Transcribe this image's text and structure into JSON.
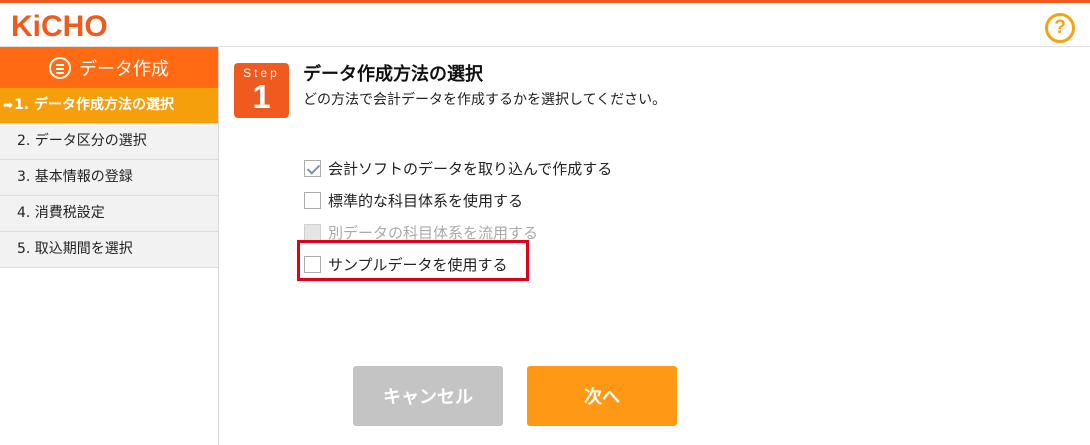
{
  "header": {
    "logo_text": "KiCHO",
    "help_icon_glyph": "?"
  },
  "sidebar": {
    "header_label": "データ作成",
    "header_icon": "list-icon",
    "items": [
      {
        "label": "1. データ作成方法の選択",
        "active": true
      },
      {
        "label": "2. データ区分の選択"
      },
      {
        "label": "3. 基本情報の登録"
      },
      {
        "label": "4. 消費税設定"
      },
      {
        "label": "5. 取込期間を選択"
      }
    ]
  },
  "step": {
    "label": "Step",
    "number": "1"
  },
  "main": {
    "title": "データ作成方法の選択",
    "subtitle": "どの方法で会計データを作成するかを選択してください。",
    "options": [
      {
        "label": "会計ソフトのデータを取り込んで作成する",
        "checked": true,
        "disabled": false
      },
      {
        "label": "標準的な科目体系を使用する",
        "checked": false,
        "disabled": false
      },
      {
        "label": "別データの科目体系を流用する",
        "checked": false,
        "disabled": true
      },
      {
        "label": "サンプルデータを使用する",
        "checked": false,
        "disabled": false
      }
    ]
  },
  "buttons": {
    "cancel_label": "キャンセル",
    "next_label": "次へ"
  },
  "colors": {
    "brand": "#f05a1e",
    "active": "#f59f0c",
    "next": "#ff9915",
    "cancel": "#c4c4c4",
    "highlight": "#e0001a"
  }
}
